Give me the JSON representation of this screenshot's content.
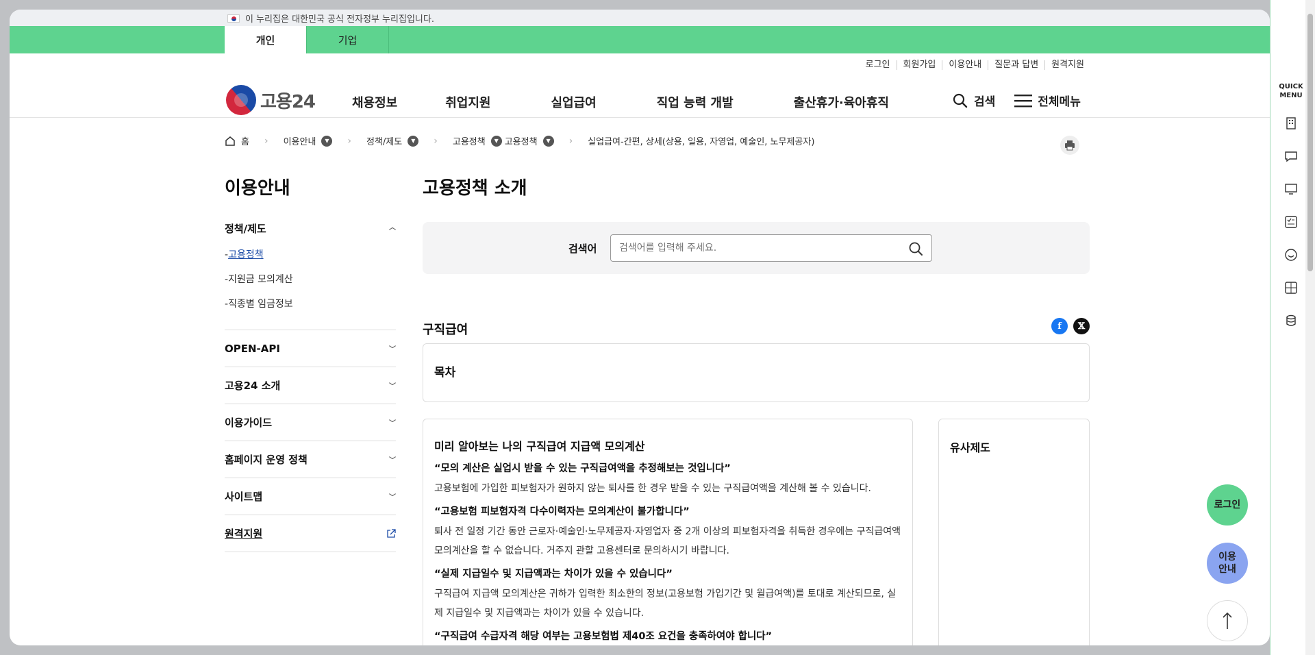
{
  "gov_banner": {
    "text": "이 누리집은 대한민국 공식 전자정부 누리집입니다."
  },
  "audience_tabs": [
    {
      "label": "개인"
    },
    {
      "label": "기업"
    }
  ],
  "utility_links": [
    "로그인",
    "회원가입",
    "이용안내",
    "질문과 답변",
    "원격지원"
  ],
  "logo": {
    "text": "고용24"
  },
  "gnb": [
    "채용정보",
    "취업지원",
    "실업급여",
    "직업 능력 개발",
    "출산휴가·육아휴직"
  ],
  "header_right": {
    "search": "검색",
    "all_menu": "전체메뉴"
  },
  "breadcrumb": {
    "home": "홈",
    "items": [
      "이용안내",
      "정책/제도",
      "고용정책",
      "고용정책"
    ],
    "current": "실업급여-간편, 상세(상용, 일용, 자영업, 예술인, 노무제공자)"
  },
  "lnb": {
    "title": "이용안내",
    "sections": [
      {
        "label": "정책/제도",
        "sub": [
          "고용정책",
          "지원금 모의계산",
          "직종별 임금정보"
        ]
      },
      {
        "label": "OPEN-API"
      },
      {
        "label": "고용24 소개"
      },
      {
        "label": "이용가이드"
      },
      {
        "label": "홈페이지 운영 정책"
      },
      {
        "label": "사이트맵"
      },
      {
        "label": "원격지원"
      }
    ]
  },
  "main": {
    "title": "고용정책 소개",
    "search": {
      "label": "검색어",
      "placeholder": "검색어를 입력해 주세요."
    },
    "section_title": "구직급여",
    "toc": "목차",
    "card": {
      "title": "미리 알아보는 나의 구직급여 지급액 모의계산",
      "items": [
        {
          "q": "“모의 계산은 실업시 받을 수 있는 구직급여액을 추정해보는 것입니다”",
          "a": "고용보험에 가입한 피보험자가 원하지 않는 퇴사를 한 경우 받을 수 있는 구직급여액을 계산해 볼 수 있습니다."
        },
        {
          "q": "“고용보험 피보험자격 다수이력자는 모의계산이 불가합니다”",
          "a": "퇴사 전 일정 기간 동안 근로자·예술인·노무제공자·자영업자 중 2개 이상의 피보험자격을 취득한 경우에는 구직급여액 모의계산을 할 수 없습니다. 거주지 관할 고용센터로 문의하시기 바랍니다."
        },
        {
          "q": "“실제 지급일수 및 지급액과는 차이가 있을 수 있습니다”",
          "a": "구직급여 지급액 모의계산은 귀하가 입력한 최소한의 정보(고용보험 가입기간 및 월급여액)를 토대로 계산되므로, 실제 지급일수 및 지급액과는 차이가 있을 수 있습니다."
        },
        {
          "q": "“구직급여 수급자격 해당 여부는 고용보험법 제40조 요건을 충족하여야 합니다”",
          "a": ""
        }
      ]
    },
    "side_card": "유사제도"
  },
  "quick_menu": {
    "title": "QUICK MENU"
  },
  "floating": {
    "login": "로그인",
    "guide": "이용 안내"
  },
  "colors": {
    "green": "#5ed38f",
    "brand_blue": "#1a4aa6",
    "facebook": "#1877f2"
  }
}
